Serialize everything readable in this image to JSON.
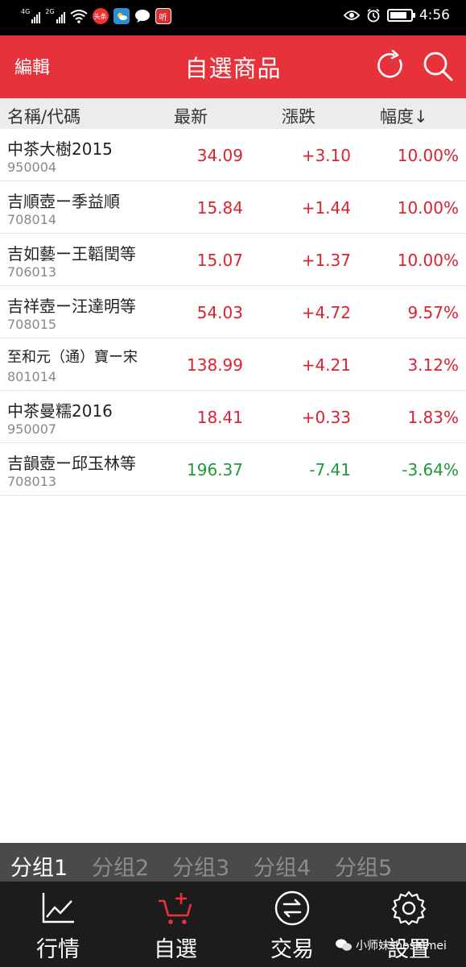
{
  "status_bar": {
    "network_left": "4G",
    "network_right": "2G",
    "news_app_label": "头条",
    "listen_app_label": "听",
    "time": "4:56"
  },
  "header": {
    "edit_label": "編輯",
    "title": "自選商品"
  },
  "columns": {
    "name": "名稱/代碼",
    "last": "最新",
    "change": "漲跌",
    "percent": "幅度↓"
  },
  "rows": [
    {
      "name": "中茶大樹2015",
      "code": "950004",
      "last": "34.09",
      "change": "+3.10",
      "percent": "10.00%",
      "trend": "up"
    },
    {
      "name": "吉順壺ー季益順",
      "code": "708014",
      "last": "15.84",
      "change": "+1.44",
      "percent": "10.00%",
      "trend": "up"
    },
    {
      "name": "吉如藝ー王韜閏等",
      "code": "706013",
      "last": "15.07",
      "change": "+1.37",
      "percent": "10.00%",
      "trend": "up"
    },
    {
      "name": "吉祥壺ー汪達明等",
      "code": "708015",
      "last": "54.03",
      "change": "+4.72",
      "percent": "9.57%",
      "trend": "up"
    },
    {
      "name": "至和元（通）寶ー宋",
      "code": "801014",
      "last": "138.99",
      "change": "+4.21",
      "percent": "3.12%",
      "trend": "up"
    },
    {
      "name": "中茶曼糯2016",
      "code": "950007",
      "last": "18.41",
      "change": "+0.33",
      "percent": "1.83%",
      "trend": "up"
    },
    {
      "name": "吉韻壺ー邱玉林等",
      "code": "708013",
      "last": "196.37",
      "change": "-7.41",
      "percent": "-3.64%",
      "trend": "down"
    }
  ],
  "groups": [
    "分组1",
    "分组2",
    "分组3",
    "分组4",
    "分组5"
  ],
  "active_group": 0,
  "nav": [
    {
      "label": "行情",
      "icon": "line-chart-icon"
    },
    {
      "label": "自選",
      "icon": "cart-plus-icon"
    },
    {
      "label": "交易",
      "icon": "exchange-icon"
    },
    {
      "label": "設置",
      "icon": "gear-icon"
    }
  ],
  "active_nav": 1,
  "watermark": "小师妹shoshimei",
  "colors": {
    "header_red": "#e8323b",
    "up_red": "#d9232e",
    "down_green": "#1f9a38",
    "nav_active": "#e8323b"
  }
}
